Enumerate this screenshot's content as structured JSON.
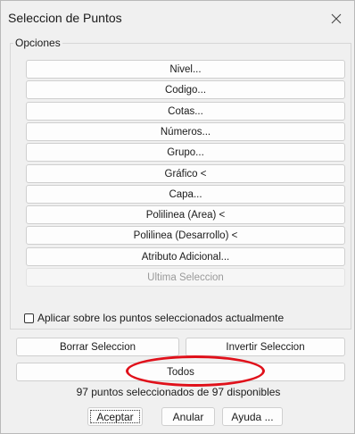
{
  "window": {
    "title": "Seleccion de Puntos",
    "close_glyph": "✕"
  },
  "group": {
    "label": "Opciones"
  },
  "options": [
    {
      "label": "Nivel...",
      "enabled": true
    },
    {
      "label": "Codigo...",
      "enabled": true
    },
    {
      "label": "Cotas...",
      "enabled": true
    },
    {
      "label": "Números...",
      "enabled": true
    },
    {
      "label": "Grupo...",
      "enabled": true
    },
    {
      "label": "Gráfico <",
      "enabled": true
    },
    {
      "label": "Capa...",
      "enabled": true
    },
    {
      "label": "Polilinea (Area) <",
      "enabled": true
    },
    {
      "label": "Polilinea (Desarrollo) <",
      "enabled": true
    },
    {
      "label": "Atributo Adicional...",
      "enabled": true
    },
    {
      "label": "Ultima Seleccion",
      "enabled": false
    }
  ],
  "apply_checkbox": {
    "label": "Aplicar sobre los puntos seleccionados actualmente",
    "checked": false
  },
  "actions": {
    "clear_label": "Borrar Seleccion",
    "invert_label": "Invertir Seleccion",
    "all_label": "Todos"
  },
  "status": {
    "text": "97 puntos seleccionados de 97 disponibles"
  },
  "footer": {
    "accept_label": "Aceptar",
    "cancel_label": "Anular",
    "help_label": "Ayuda ..."
  },
  "annotation": {
    "color": "#e0101a"
  }
}
